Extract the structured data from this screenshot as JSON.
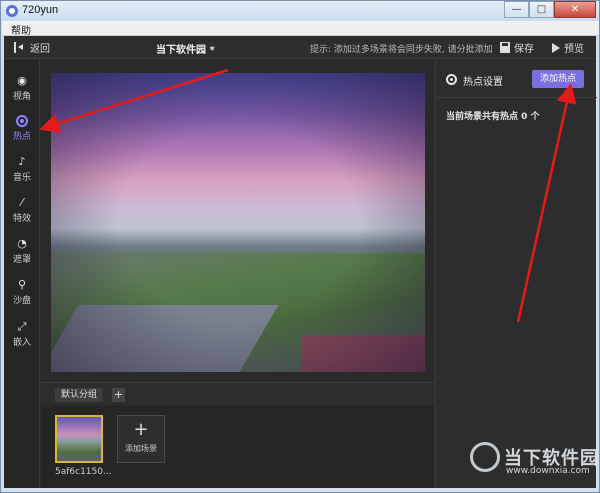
{
  "window": {
    "title": "720yun",
    "min": "—",
    "max": "□",
    "close": "✕"
  },
  "menu": {
    "help": "帮助"
  },
  "topbar": {
    "back_label": "返回",
    "project_title": "当下软件园 *",
    "tip": "提示: 添加过多场景将会同步失败, 请分批添加",
    "save_label": "保存",
    "preview_label": "预览"
  },
  "nav": {
    "items": [
      {
        "label": "视角",
        "icon": "eye-icon"
      },
      {
        "label": "热点",
        "icon": "hotspot-icon",
        "active": true
      },
      {
        "label": "音乐",
        "icon": "music-icon"
      },
      {
        "label": "特效",
        "icon": "magic-wand-icon"
      },
      {
        "label": "遮罩",
        "icon": "mask-icon"
      },
      {
        "label": "沙盘",
        "icon": "map-pin-icon"
      },
      {
        "label": "嵌入",
        "icon": "embed-icon"
      }
    ]
  },
  "scenes": {
    "group_label": "默认分组",
    "add_group": "+",
    "items": [
      {
        "name": "5af6c1150..."
      }
    ],
    "add_scene_plus": "+",
    "add_scene_label": "添加场景"
  },
  "panel": {
    "title": "热点设置",
    "add_hotspot_label": "添加热点",
    "hotspot_count_text": "当前场景共有热点 0 个"
  },
  "watermark": {
    "text": "当下软件园",
    "url": "www.downxia.com"
  },
  "colors": {
    "accent": "#7b6fe0",
    "active_nav": "#8f86ff",
    "arrow": "#e31b1b",
    "thumb_border": "#d6b63e"
  }
}
